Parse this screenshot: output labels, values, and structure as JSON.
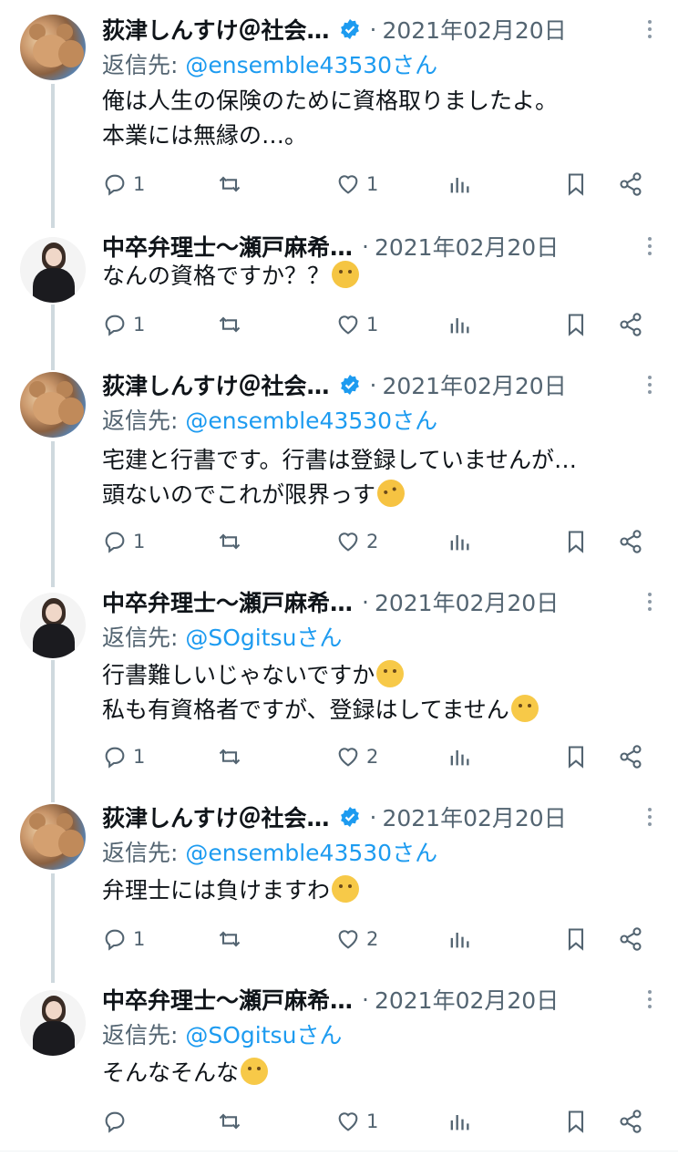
{
  "tweets": [
    {
      "author": "荻津しんすけ＠社会…",
      "verified": true,
      "dot": "·",
      "date": "2021年02月20日",
      "reply_prefix": "返信先: ",
      "reply_handle": "@ensemble43530さん",
      "lines": [
        "俺は人生の保険のために資格取りましたよ。",
        "本業には無縁の…。"
      ],
      "replies": "1",
      "retweets": "",
      "likes": "1",
      "avatar": "bear-avatar"
    },
    {
      "author": "中卒弁理士〜瀬戸麻希…",
      "verified": false,
      "dot": "·",
      "date": "2021年02月20日",
      "reply_prefix": "",
      "reply_handle": "",
      "lines": [
        "なんの資格ですか？？"
      ],
      "line_emoji": [
        "smiling-face-with-hearts"
      ],
      "replies": "1",
      "retweets": "",
      "likes": "1",
      "avatar": "woman-avatar"
    },
    {
      "author": "荻津しんすけ＠社会…",
      "verified": true,
      "dot": "·",
      "date": "2021年02月20日",
      "reply_prefix": "返信先: ",
      "reply_handle": "@ensemble43530さん",
      "lines": [
        "宅建と行書です。行書は登録していませんが…",
        "頭ないのでこれが限界っす"
      ],
      "line_emoji": [
        "",
        "rolling-on-floor-laughing"
      ],
      "replies": "1",
      "retweets": "",
      "likes": "2",
      "avatar": "bear-avatar"
    },
    {
      "author": "中卒弁理士〜瀬戸麻希…",
      "verified": false,
      "dot": "·",
      "date": "2021年02月20日",
      "reply_prefix": "返信先: ",
      "reply_handle": "@SOgitsuさん",
      "lines": [
        "行書難しいじゃないですか",
        "私も有資格者ですが、登録はしてません"
      ],
      "line_emoji": [
        "pleading-face",
        "grinning-sweat"
      ],
      "replies": "1",
      "retweets": "",
      "likes": "2",
      "avatar": "woman-avatar"
    },
    {
      "author": "荻津しんすけ＠社会…",
      "verified": true,
      "dot": "·",
      "date": "2021年02月20日",
      "reply_prefix": "返信先: ",
      "reply_handle": "@ensemble43530さん",
      "lines": [
        "弁理士には負けますわ"
      ],
      "line_emoji": [
        "loudly-crying-face"
      ],
      "replies": "1",
      "retweets": "",
      "likes": "2",
      "avatar": "bear-avatar"
    },
    {
      "author": "中卒弁理士〜瀬戸麻希…",
      "verified": false,
      "dot": "·",
      "date": "2021年02月20日",
      "reply_prefix": "返信先: ",
      "reply_handle": "@SOgitsuさん",
      "lines": [
        "そんなそんな"
      ],
      "line_emoji": [
        "loudly-crying-face"
      ],
      "replies": "",
      "retweets": "",
      "likes": "1",
      "avatar": "woman-avatar"
    }
  ],
  "colors": {
    "link": "#1d9bf0",
    "secondary": "#536471",
    "verified": "#1d9bf0",
    "thread_line": "#cfd9de"
  }
}
